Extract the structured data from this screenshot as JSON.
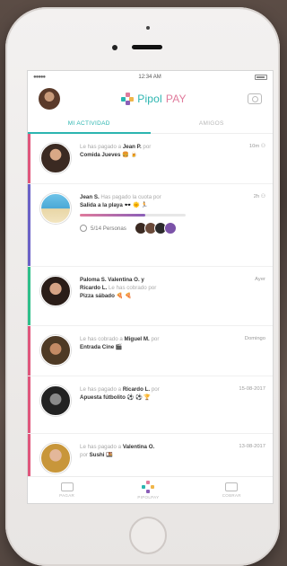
{
  "status_bar": {
    "time": "12:34 AM",
    "signal": "●●●●●"
  },
  "app": {
    "logo_text": "Pipol",
    "logo_accent": "PAY"
  },
  "tabs": [
    {
      "label": "MI ACTIVIDAD",
      "active": true
    },
    {
      "label": "AMIGOS",
      "active": false
    }
  ],
  "feed": [
    {
      "color": "#e0567c",
      "lines": [
        [
          [
            "muted",
            "Le has pagado a "
          ],
          [
            "strong",
            "Jean P."
          ],
          [
            "muted",
            " por"
          ]
        ],
        [
          [
            "strong",
            "Comida Jueves 🍔 🍺"
          ]
        ]
      ],
      "date": "10m ⚇"
    },
    {
      "color": "#6b62c7",
      "lines": [
        [
          [
            "strong",
            "Jean S."
          ],
          [
            "muted",
            " Has pagado la cuota por"
          ]
        ],
        [
          [
            "strong",
            "Salida a la playa 🕶️ 🌞 🏃"
          ]
        ]
      ],
      "date": "2h ⚇",
      "progress": 0.62,
      "people_count": "5/14 Personas"
    },
    {
      "color": "#2fbf8a",
      "lines": [
        [
          [
            "strong",
            "Paloma S. Valentina O. y"
          ]
        ],
        [
          [
            "strong",
            "Ricardo L."
          ],
          [
            "muted",
            " Le has cobrado por"
          ]
        ],
        [
          [
            "strong",
            "Pizza sábado 🍕 🍕"
          ]
        ]
      ],
      "date": "Ayer"
    },
    {
      "color": "#e0567c",
      "lines": [
        [
          [
            "muted",
            "Le has cobrado a "
          ],
          [
            "strong",
            "Miguel M."
          ],
          [
            "muted",
            " por"
          ]
        ],
        [
          [
            "strong",
            "Entrada Cine 🎬"
          ]
        ]
      ],
      "date": "Domingo"
    },
    {
      "color": "#e0567c",
      "lines": [
        [
          [
            "muted",
            "Le has pagado a "
          ],
          [
            "strong",
            "Ricardo L."
          ],
          [
            "muted",
            " por"
          ]
        ],
        [
          [
            "strong",
            "Apuesta fútbolito ⚽ ⚽ 🏆"
          ]
        ]
      ],
      "date": "15-08-2017"
    },
    {
      "color": "#e0567c",
      "lines": [
        [
          [
            "muted",
            "Le has pagado a "
          ],
          [
            "strong",
            "Valentina O."
          ]
        ],
        [
          [
            "muted",
            "por "
          ],
          [
            "strong",
            "Sushi 🍱"
          ]
        ]
      ],
      "date": "13-08-2017"
    }
  ],
  "bottom_nav": [
    {
      "label": "PAGAR",
      "icon": "wallet-icon"
    },
    {
      "label": "PIPOLPAY",
      "icon": "pipolpay-logo-icon"
    },
    {
      "label": "COBRAR",
      "icon": "wallet-icon"
    }
  ]
}
